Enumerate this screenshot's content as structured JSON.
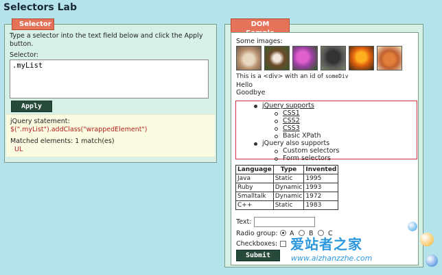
{
  "page": {
    "title": "Selectors Lab"
  },
  "selector_panel": {
    "title": "Selector",
    "instructions": "Type a selector into the text field below and click the Apply button.",
    "selector_label": "Selector:",
    "selector_value": ".myList",
    "apply_label": "Apply",
    "statement_label": "jQuery statement:",
    "statement_code": "$(\".myList\").addClass(\"wrappedElement\")",
    "matched_label": "Matched elements: 1 match(es)",
    "matched_item": "UL"
  },
  "dom_panel": {
    "title": "DOM Sample",
    "images_label": "Some images:",
    "div_text_prefix": "This is a <div> with an id of ",
    "div_text_code": "someDiv",
    "hello": "Hello",
    "goodbye": "Goodbye",
    "list": {
      "item1": "jQuery supports",
      "item1_children": [
        "CSS1",
        "CSS2",
        "CSS3",
        "Basic XPath"
      ],
      "item2": "jQuery also supports",
      "item2_children": [
        "Custom selectors",
        "Form selectors"
      ]
    },
    "table": {
      "headers": [
        "Language",
        "Type",
        "Invented"
      ],
      "rows": [
        [
          "Java",
          "Static",
          "1995"
        ],
        [
          "Ruby",
          "Dynamic",
          "1993"
        ],
        [
          "Smalltalk",
          "Dynamic",
          "1972"
        ],
        [
          "C++",
          "Static",
          "1983"
        ]
      ]
    },
    "text_label": "Text:",
    "radio_label": "Radio group:",
    "radio_options": [
      "A",
      "B",
      "C"
    ],
    "radio_selected": "A",
    "checkbox_label": "Checkboxes:",
    "submit_label": "Submit"
  },
  "watermark": {
    "text": "爱站者之家",
    "url": "www.aizhanzzhe.com"
  },
  "colors": {
    "background": "#b4e3ec",
    "panel_title": "#e5735a",
    "button": "#284a3a",
    "list_border": "#d03040",
    "watermark": "#2b98de"
  }
}
